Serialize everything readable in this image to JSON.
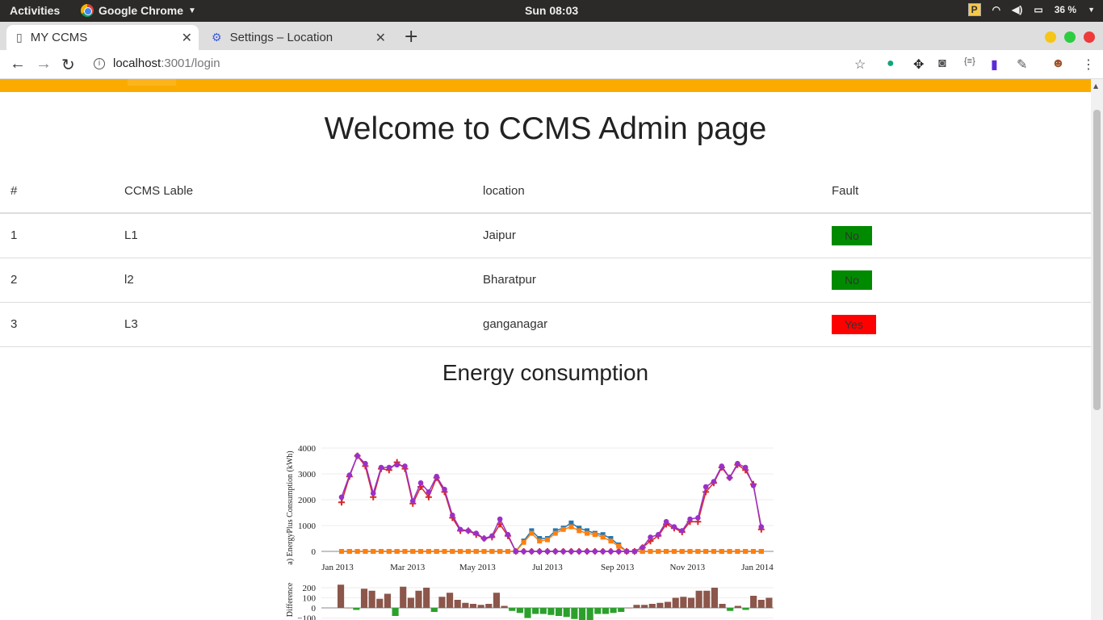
{
  "os": {
    "activities": "Activities",
    "app_name": "Google Chrome",
    "clock": "Sun 08:03",
    "battery": "36 %"
  },
  "browser": {
    "tabs": [
      {
        "label": "MY CCMS",
        "active": true
      },
      {
        "label": "Settings – Location",
        "active": false
      }
    ],
    "url_host": "localhost",
    "url_rest": ":3001/login"
  },
  "page": {
    "title": "Welcome to CCMS Admin page",
    "table": {
      "headers": [
        "#",
        "CCMS Lable",
        "location",
        "Fault"
      ],
      "rows": [
        {
          "num": "1",
          "label": "L1",
          "location": "Jaipur",
          "fault": "No"
        },
        {
          "num": "2",
          "label": "l2",
          "location": "Bharatpur",
          "fault": "No"
        },
        {
          "num": "3",
          "label": "L3",
          "location": "ganganagar",
          "fault": "Yes"
        }
      ]
    },
    "energy_title": "Energy consumption"
  },
  "colors": {
    "accent_bar": "#fbab00",
    "fault_no": "#008a00",
    "fault_yes": "#ff0000"
  },
  "chart_data": [
    {
      "type": "line",
      "ylabel": "a) EnergyPlus Consumption (kWh)",
      "x_tick_labels": [
        "Jan 2013",
        "Mar 2013",
        "May 2013",
        "Jul 2013",
        "Sep 2013",
        "Nov 2013",
        "Jan 2014"
      ],
      "y_tick_labels": [
        "0",
        "1000",
        "2000",
        "3000",
        "4000"
      ],
      "ylim": [
        0,
        4000
      ],
      "x_index_range": [
        0,
        52
      ],
      "series": [
        {
          "color": "#d62728",
          "marker": "plus",
          "values": [
            1900,
            2900,
            3700,
            3300,
            2100,
            3200,
            3150,
            3450,
            3200,
            1850,
            2500,
            2100,
            2850,
            2300,
            1300,
            800,
            800,
            650,
            500,
            550,
            1050,
            600,
            0,
            0,
            0,
            0,
            0,
            0,
            0,
            0,
            0,
            0,
            0,
            0,
            0,
            0,
            0,
            0,
            150,
            400,
            600,
            1050,
            900,
            750,
            1150,
            1150,
            2300,
            2650,
            3250,
            2850,
            3350,
            3150,
            2600,
            850
          ]
        },
        {
          "color": "#1f77b4",
          "marker": "square",
          "values": [
            0,
            0,
            0,
            0,
            0,
            0,
            0,
            0,
            0,
            0,
            0,
            0,
            0,
            0,
            0,
            0,
            0,
            0,
            0,
            0,
            0,
            0,
            0,
            400,
            800,
            500,
            500,
            800,
            900,
            1100,
            900,
            800,
            700,
            650,
            500,
            250,
            0,
            0,
            0,
            0,
            0,
            0,
            0,
            0,
            0,
            0,
            0,
            0,
            0,
            0,
            0,
            0,
            0,
            0
          ]
        },
        {
          "color": "#ff7f0e",
          "marker": "square",
          "values": [
            0,
            0,
            0,
            0,
            0,
            0,
            0,
            0,
            0,
            0,
            0,
            0,
            0,
            0,
            0,
            0,
            0,
            0,
            0,
            0,
            0,
            0,
            0,
            350,
            700,
            400,
            450,
            700,
            850,
            950,
            800,
            700,
            650,
            550,
            400,
            200,
            0,
            0,
            0,
            0,
            0,
            0,
            0,
            0,
            0,
            0,
            0,
            0,
            0,
            0,
            0,
            0,
            0,
            0
          ]
        },
        {
          "color": "#9b30c8",
          "marker": "circle",
          "values": [
            2100,
            2950,
            3700,
            3400,
            2250,
            3250,
            3250,
            3350,
            3300,
            1950,
            2650,
            2300,
            2900,
            2400,
            1400,
            850,
            800,
            700,
            500,
            600,
            1250,
            650,
            0,
            0,
            0,
            0,
            0,
            0,
            0,
            0,
            0,
            0,
            0,
            0,
            0,
            0,
            0,
            0,
            150,
            550,
            650,
            1150,
            950,
            800,
            1250,
            1300,
            2500,
            2700,
            3300,
            2850,
            3400,
            3250,
            2550,
            950
          ]
        }
      ]
    },
    {
      "type": "bar",
      "ylabel": "Difference",
      "y_tick_labels": [
        "200",
        "100",
        "0",
        "−100"
      ],
      "ylim": [
        -100,
        200
      ],
      "values": [
        230,
        0,
        -20,
        190,
        170,
        90,
        140,
        -80,
        210,
        100,
        170,
        200,
        -40,
        110,
        150,
        80,
        50,
        40,
        30,
        40,
        150,
        20,
        -30,
        -50,
        -100,
        -60,
        -60,
        -70,
        -80,
        -90,
        -110,
        -130,
        -120,
        -60,
        -60,
        -50,
        -40,
        0,
        30,
        30,
        40,
        50,
        60,
        100,
        110,
        100,
        170,
        170,
        200,
        40,
        -30,
        20,
        -20,
        120,
        80,
        100
      ],
      "colors": {
        "positive": "#8c564b",
        "negative": "#2ca02c"
      }
    }
  ]
}
